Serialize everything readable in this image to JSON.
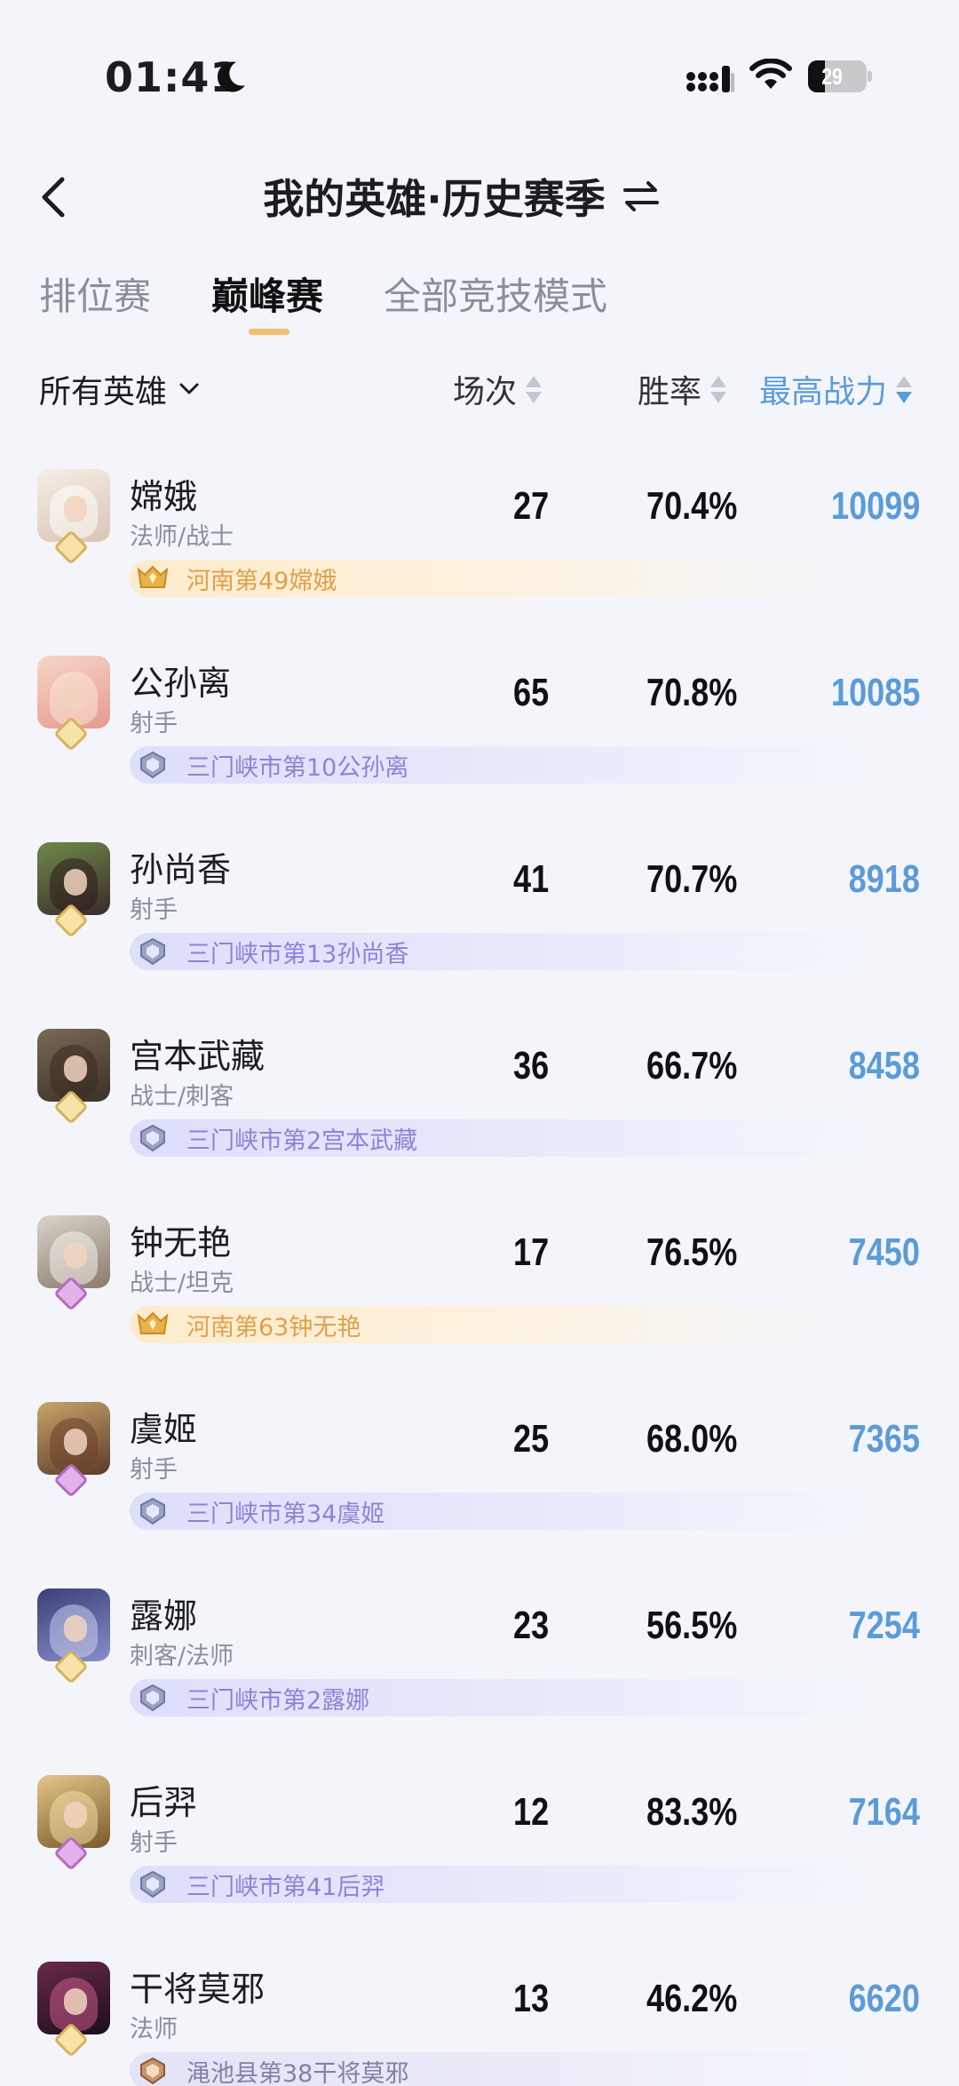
{
  "status_bar": {
    "time": "01:41",
    "battery": "29"
  },
  "header": {
    "title": "我的英雄·历史赛季"
  },
  "tabs": [
    {
      "label": "排位赛",
      "active": false
    },
    {
      "label": "巅峰赛",
      "active": true
    },
    {
      "label": "全部竞技模式",
      "active": false
    }
  ],
  "columns": {
    "filter": "所有英雄",
    "games": "场次",
    "winrate": "胜率",
    "power": "最高战力"
  },
  "heroes": [
    {
      "name": "嫦娥",
      "role": "法师/战士",
      "games": "27",
      "winrate": "70.4%",
      "power": "10099",
      "rank": "河南第49嫦娥",
      "tier": "gold"
    },
    {
      "name": "公孙离",
      "role": "射手",
      "games": "65",
      "winrate": "70.8%",
      "power": "10085",
      "rank": "三门峡市第10公孙离",
      "tier": "silver"
    },
    {
      "name": "孙尚香",
      "role": "射手",
      "games": "41",
      "winrate": "70.7%",
      "power": "8918",
      "rank": "三门峡市第13孙尚香",
      "tier": "silver"
    },
    {
      "name": "宫本武藏",
      "role": "战士/刺客",
      "games": "36",
      "winrate": "66.7%",
      "power": "8458",
      "rank": "三门峡市第2宫本武藏",
      "tier": "silver"
    },
    {
      "name": "钟无艳",
      "role": "战士/坦克",
      "games": "17",
      "winrate": "76.5%",
      "power": "7450",
      "rank": "河南第63钟无艳",
      "tier": "gold"
    },
    {
      "name": "虞姬",
      "role": "射手",
      "games": "25",
      "winrate": "68.0%",
      "power": "7365",
      "rank": "三门峡市第34虞姬",
      "tier": "silver"
    },
    {
      "name": "露娜",
      "role": "刺客/法师",
      "games": "23",
      "winrate": "56.5%",
      "power": "7254",
      "rank": "三门峡市第2露娜",
      "tier": "silver"
    },
    {
      "name": "后羿",
      "role": "射手",
      "games": "12",
      "winrate": "83.3%",
      "power": "7164",
      "rank": "三门峡市第41后羿",
      "tier": "silver"
    },
    {
      "name": "干将莫邪",
      "role": "法师",
      "games": "13",
      "winrate": "46.2%",
      "power": "6620",
      "rank": "渑池县第38干将莫邪",
      "tier": "bronze"
    }
  ],
  "colors": {
    "accent_blue": "#5b9bd8",
    "tab_underline": "#f0c070",
    "gold_text": "#e1a04a",
    "silver_text": "#8a84d6"
  }
}
